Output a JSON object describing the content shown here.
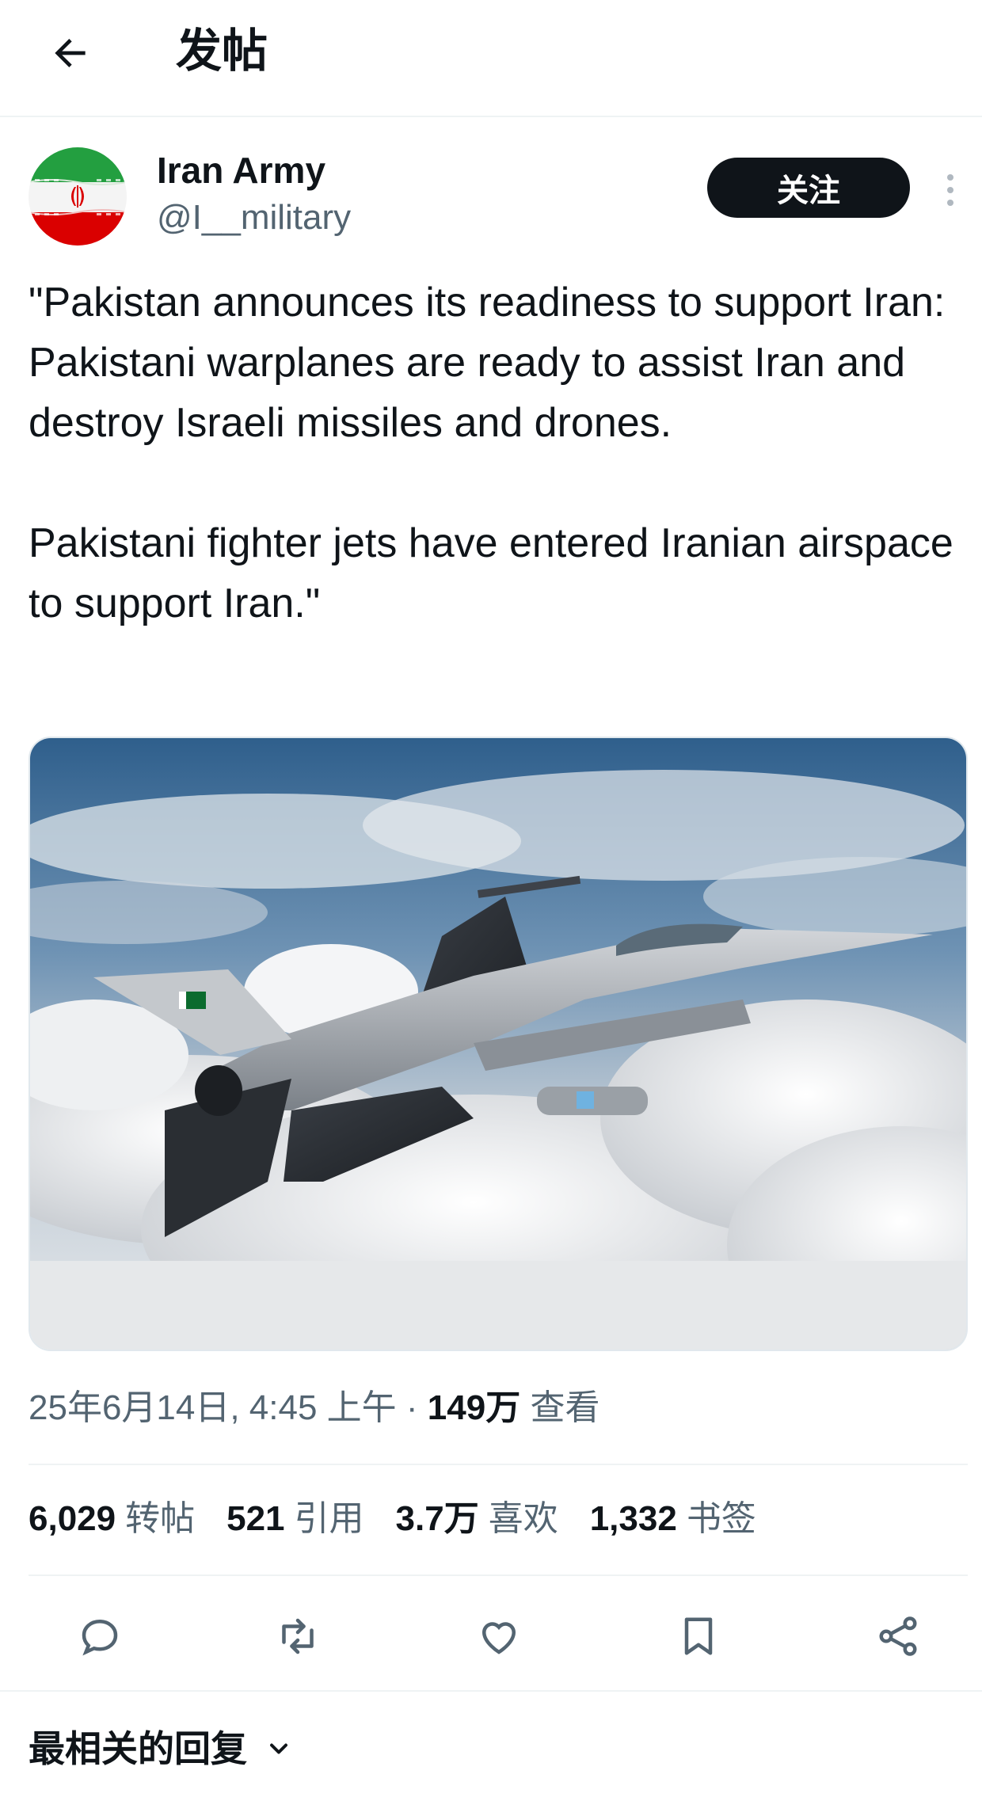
{
  "header": {
    "title": "发帖",
    "back_icon": "arrow-left-icon"
  },
  "author": {
    "name": "Iran Army",
    "handle": "@I__military",
    "avatar": "iran-flag-avatar",
    "follow_label": "关注",
    "more_icon": "more-vertical-icon"
  },
  "tweet": {
    "paragraphs": [
      "\"Pakistan announces its readiness to support Iran: Pakistani warplanes are ready to assist Iran and destroy Israeli missiles and drones.",
      "Pakistani fighter jets have entered Iranian airspace to support Iran.\""
    ],
    "media": "fighter-jet-above-clouds-photo"
  },
  "meta": {
    "timestamp": "25年6月14日, 4:45 上午",
    "separator": "·",
    "views_count": "149万",
    "views_label": "查看"
  },
  "stats": {
    "reposts": {
      "count": "6,029",
      "label": "转帖"
    },
    "quotes": {
      "count": "521",
      "label": "引用"
    },
    "likes": {
      "count": "3.7万",
      "label": "喜欢"
    },
    "bookmarks": {
      "count": "1,332",
      "label": "书签"
    }
  },
  "actions": [
    "reply-icon",
    "repost-icon",
    "like-icon",
    "bookmark-icon",
    "share-icon"
  ],
  "replies": {
    "sort_label": "最相关的回复",
    "sort_icon": "chevron-down-icon"
  },
  "colors": {
    "text": "#0f1419",
    "secondary": "#536471",
    "divider": "#eff3f4",
    "follow_button": "#0f1419"
  }
}
